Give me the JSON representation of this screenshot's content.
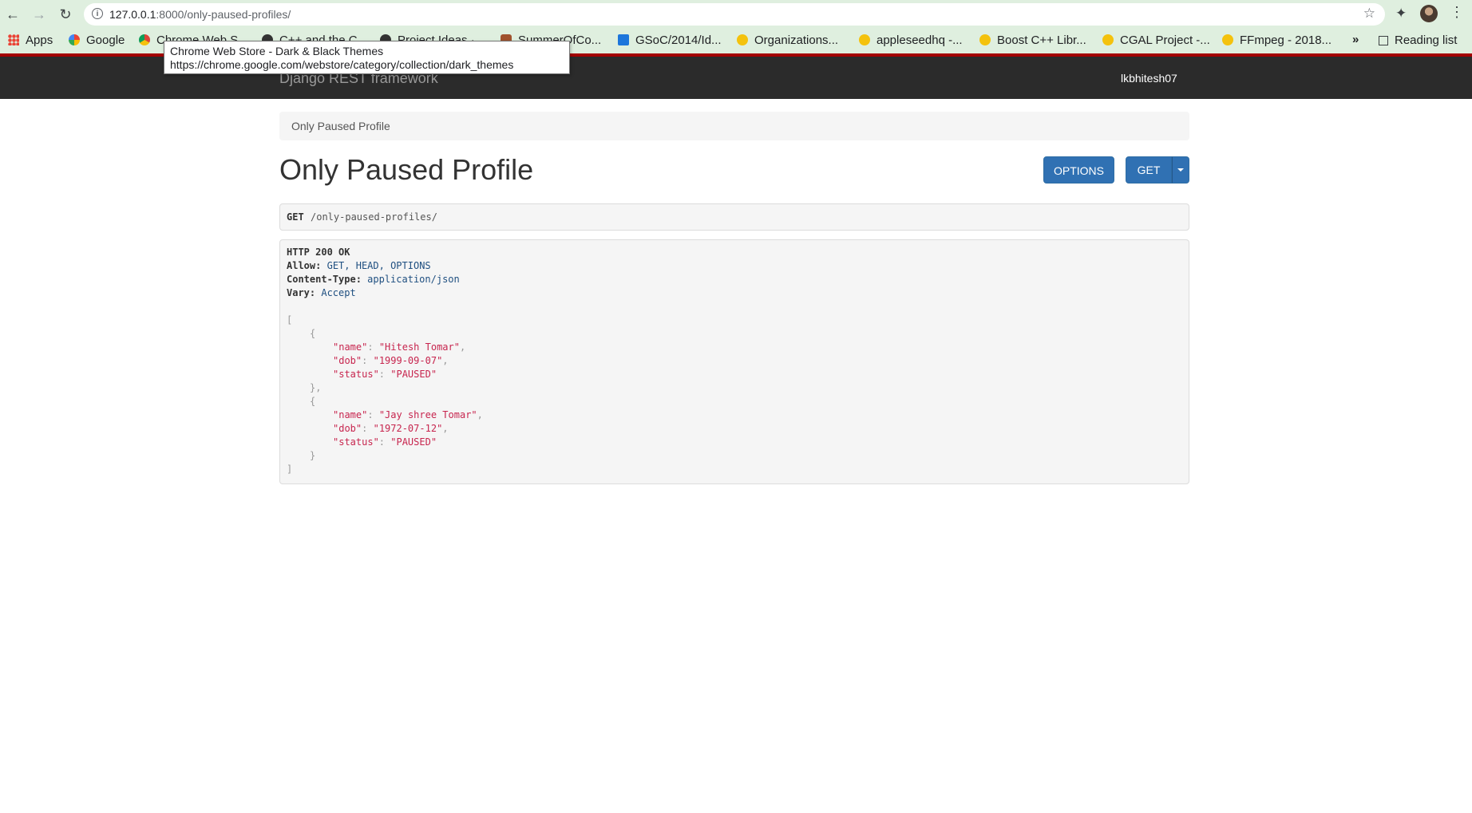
{
  "browser": {
    "url_host": "127.0.0.1",
    "url_rest": ":8000/only-paused-profiles/",
    "bookmarks": [
      {
        "label": "Apps",
        "color": "#ea4335"
      },
      {
        "label": "Google",
        "color": "#4285f4"
      },
      {
        "label": "Chrome Web S...",
        "color": "#db4437"
      },
      {
        "label": "C++ and the C...",
        "color": "#333333"
      },
      {
        "label": "Project Ideas ·...",
        "color": "#333333"
      },
      {
        "label": "SummerOfCo...",
        "color": "#a0522d"
      },
      {
        "label": "GSoC/2014/Id...",
        "color": "#1d76db"
      },
      {
        "label": "Organizations...",
        "color": "#f4c20d"
      },
      {
        "label": "appleseedhq -...",
        "color": "#f4c20d"
      },
      {
        "label": "Boost C++ Libr...",
        "color": "#f4c20d"
      },
      {
        "label": "CGAL Project -...",
        "color": "#f4c20d"
      },
      {
        "label": "FFmpeg - 2018...",
        "color": "#f4c20d"
      }
    ],
    "overflow": "»",
    "reading_list": "Reading list",
    "tooltip_title": "Chrome Web Store - Dark & Black Themes",
    "tooltip_url": "https://chrome.google.com/webstore/category/collection/dark_themes"
  },
  "navbar": {
    "brand": "Django REST framework",
    "user": "lkbhitesh07"
  },
  "breadcrumb": "Only Paused Profile",
  "page_title": "Only Paused Profile",
  "buttons": {
    "options": "OPTIONS",
    "get": "GET"
  },
  "request": {
    "method": "GET",
    "path": "/only-paused-profiles/"
  },
  "response": {
    "status": "HTTP 200 OK",
    "headers": [
      {
        "name": "Allow:",
        "value": "GET, HEAD, OPTIONS"
      },
      {
        "name": "Content-Type:",
        "value": "application/json"
      },
      {
        "name": "Vary:",
        "value": "Accept"
      }
    ],
    "profiles": [
      {
        "name": "Hitesh Tomar",
        "dob": "1999-09-07",
        "status": "PAUSED"
      },
      {
        "name": "Jay shree Tomar",
        "dob": "1972-07-12",
        "status": "PAUSED"
      }
    ]
  }
}
